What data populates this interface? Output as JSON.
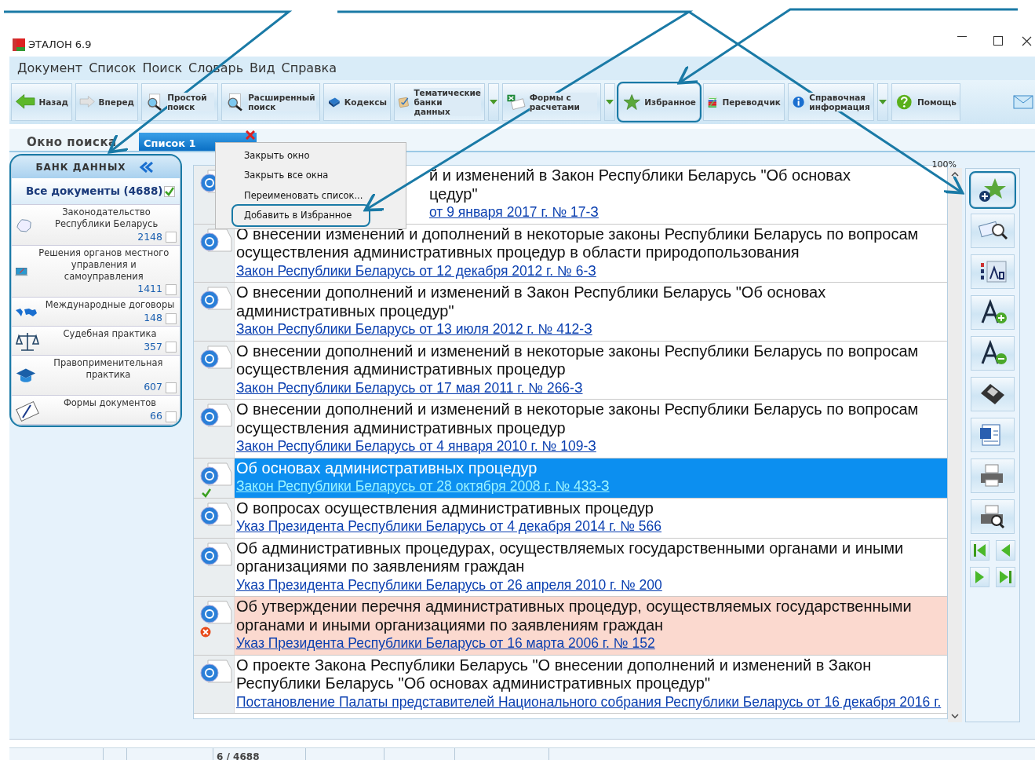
{
  "window": {
    "title": "ЭТАЛОН 6.9"
  },
  "menu": [
    "Документ",
    "Список",
    "Поиск",
    "Словарь",
    "Вид",
    "Справка"
  ],
  "toolbar": [
    {
      "label": "Назад",
      "dropdown": false,
      "annotated": false
    },
    {
      "label": "Вперед",
      "dropdown": false,
      "annotated": false
    },
    {
      "label": "Простой поиск",
      "dropdown": false,
      "annotated": false
    },
    {
      "label": "Расширенный поиск",
      "dropdown": false,
      "annotated": false
    },
    {
      "label": "Кодексы",
      "dropdown": false,
      "annotated": false
    },
    {
      "label": "Тематические банки данных",
      "dropdown": true,
      "annotated": false
    },
    {
      "label": "Формы с расчетами",
      "dropdown": true,
      "annotated": false
    },
    {
      "label": "Избранное",
      "dropdown": false,
      "annotated": true
    },
    {
      "label": "Переводчик",
      "dropdown": false,
      "annotated": false
    },
    {
      "label": "Справочная информация",
      "dropdown": true,
      "annotated": false
    },
    {
      "label": "Помощь",
      "dropdown": false,
      "annotated": false
    }
  ],
  "search_window_label": "Окно поиска",
  "tabs": [
    {
      "label": "Список 1",
      "selected": true
    }
  ],
  "context_menu": [
    {
      "label": "Закрыть окно",
      "annotated": false
    },
    {
      "label": "Закрыть все окна",
      "annotated": false
    },
    {
      "label": "Переименовать список...",
      "annotated": false
    },
    {
      "label": "Добавить в Избранное",
      "annotated": true
    }
  ],
  "data_bank": {
    "title": "БАНК ДАННЫХ",
    "annotated": true,
    "all": {
      "label": "Все документы (4688)",
      "checked": true
    },
    "items": [
      {
        "name": "Законодательство Республики Беларусь",
        "count": "2148",
        "checked": false
      },
      {
        "name": "Решения органов местного управления и самоуправления",
        "count": "1411",
        "checked": false
      },
      {
        "name": "Международные договоры",
        "count": "148",
        "checked": false
      },
      {
        "name": "Судебная практика",
        "count": "357",
        "checked": false
      },
      {
        "name": "Правоприменительная практика",
        "count": "607",
        "checked": false
      },
      {
        "name": "Формы документов",
        "count": "66",
        "checked": false
      }
    ]
  },
  "zoom": "100%",
  "documents": [
    {
      "kind": "partial",
      "lines": [
        "й и изменений в Закон Республики Беларусь \"Об основах",
        "цедур\""
      ],
      "link": "от 9 января 2017 г. № 17-З",
      "selected": false,
      "checked": false,
      "excluded": false
    },
    {
      "kind": "full",
      "title": "О внесении изменений и дополнений в некоторые законы Республики Беларусь по вопросам осуществления административных процедур в области природопользования",
      "link": "Закон Республики Беларусь от 12 декабря 2012 г. № 6-З",
      "selected": false,
      "checked": false,
      "excluded": false
    },
    {
      "kind": "full",
      "title": "О внесении дополнений и изменений в Закон Республики Беларусь \"Об основах административных процедур\"",
      "link": "Закон Республики Беларусь от 13 июля 2012 г. № 412-З",
      "selected": false,
      "checked": false,
      "excluded": false
    },
    {
      "kind": "full",
      "title": "О внесении дополнений и изменений в некоторые законы Республики Беларусь по вопросам осуществления административных процедур",
      "link": "Закон Республики Беларусь от 17 мая 2011 г. № 266-З",
      "selected": false,
      "checked": false,
      "excluded": false
    },
    {
      "kind": "full",
      "title": "О внесении дополнений и изменений в некоторые законы Республики Беларусь по вопросам осуществления административных процедур",
      "link": "Закон Республики Беларусь от 4 января 2010 г. № 109-З",
      "selected": false,
      "checked": false,
      "excluded": false
    },
    {
      "kind": "full",
      "title": "Об основах административных процедур",
      "link": "Закон Республики Беларусь от 28 октября 2008 г. № 433-З",
      "selected": true,
      "checked": true,
      "excluded": false
    },
    {
      "kind": "full",
      "title": "О вопросах осуществления административных процедур",
      "link": "Указ Президента Республики Беларусь от 4 декабря 2014 г. № 566",
      "selected": false,
      "checked": false,
      "excluded": false
    },
    {
      "kind": "full",
      "title": "Об административных процедурах, осуществляемых государственными органами и иными организациями по заявлениям граждан",
      "link": "Указ Президента Республики Беларусь от 26 апреля 2010 г. № 200",
      "selected": false,
      "checked": false,
      "excluded": false
    },
    {
      "kind": "full",
      "title": "Об утверждении перечня административных процедур, осуществляемых государственными органами и иными организациями по заявлениям граждан",
      "link": "Указ Президента Республики Беларусь от 16 марта 2006 г. № 152",
      "selected": false,
      "checked": false,
      "excluded": true
    },
    {
      "kind": "full",
      "title": "О проекте Закона Республики Беларусь \"О внесении дополнений и изменений в Закон Республики Беларусь \"Об основах административных процедур\"",
      "link": "Постановление Палаты представителей Национального собрания Республики Беларусь от 16 декабря 2016 г.",
      "selected": false,
      "checked": false,
      "excluded": false
    }
  ],
  "side_tools": [
    {
      "annotated": true
    },
    {
      "annotated": false
    },
    {
      "annotated": false
    },
    {
      "annotated": false
    },
    {
      "annotated": false
    },
    {
      "annotated": false
    },
    {
      "annotated": false
    },
    {
      "annotated": false
    },
    {
      "annotated": false
    }
  ],
  "status_bar": {
    "position": "6 / 4688"
  }
}
